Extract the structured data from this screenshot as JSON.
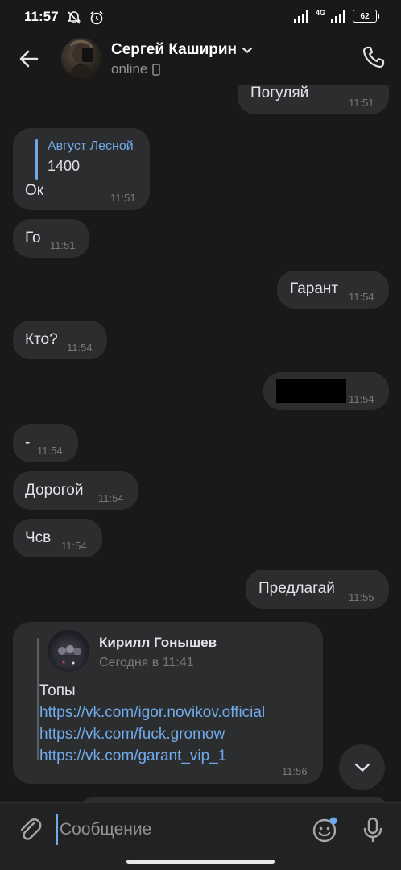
{
  "status_bar": {
    "time": "11:57",
    "network": "4G",
    "battery": "62"
  },
  "header": {
    "contact_name": "Сергей Каширин",
    "contact_status": "online"
  },
  "messages": [
    {
      "dir": "out",
      "text": "Погуляй",
      "time": "11:51"
    },
    {
      "dir": "in",
      "reply_author": "Август Лесной",
      "reply_text": "1400",
      "text": "Ок",
      "time": "11:51"
    },
    {
      "dir": "in",
      "text": "Го",
      "time": "11:51"
    },
    {
      "dir": "out",
      "text": "Гарант",
      "time": "11:54"
    },
    {
      "dir": "in",
      "text": "Кто?",
      "time": "11:54"
    },
    {
      "dir": "out",
      "text": "",
      "time": "11:54"
    },
    {
      "dir": "in",
      "text": "-",
      "time": "11:54"
    },
    {
      "dir": "in",
      "text": "Дорогой",
      "time": "11:54"
    },
    {
      "dir": "in",
      "text": "Чсв",
      "time": "11:54"
    },
    {
      "dir": "out",
      "text": "Предлагай",
      "time": "11:55"
    },
    {
      "dir": "in",
      "forwarded": {
        "author": "Кирилл Гонышев",
        "date": "Сегодня в 11:41",
        "text": "Топы",
        "links": [
          "https://vk.com/igor.novikov.official",
          "https://vk.com/fuck.gromow",
          "https://vk.com/garant_vip_1"
        ]
      },
      "time": "11:56"
    }
  ],
  "composer": {
    "placeholder": "Сообщение"
  },
  "colors": {
    "background": "#19191a",
    "bubble": "#2c2d2e",
    "accent": "#71aaeb",
    "muted": "#76787a"
  },
  "icons": [
    "back-arrow-icon",
    "phone-icon",
    "phone-device-icon",
    "chevron-down-icon",
    "attach-icon",
    "emoji-icon",
    "mic-icon",
    "scroll-down-icon"
  ]
}
